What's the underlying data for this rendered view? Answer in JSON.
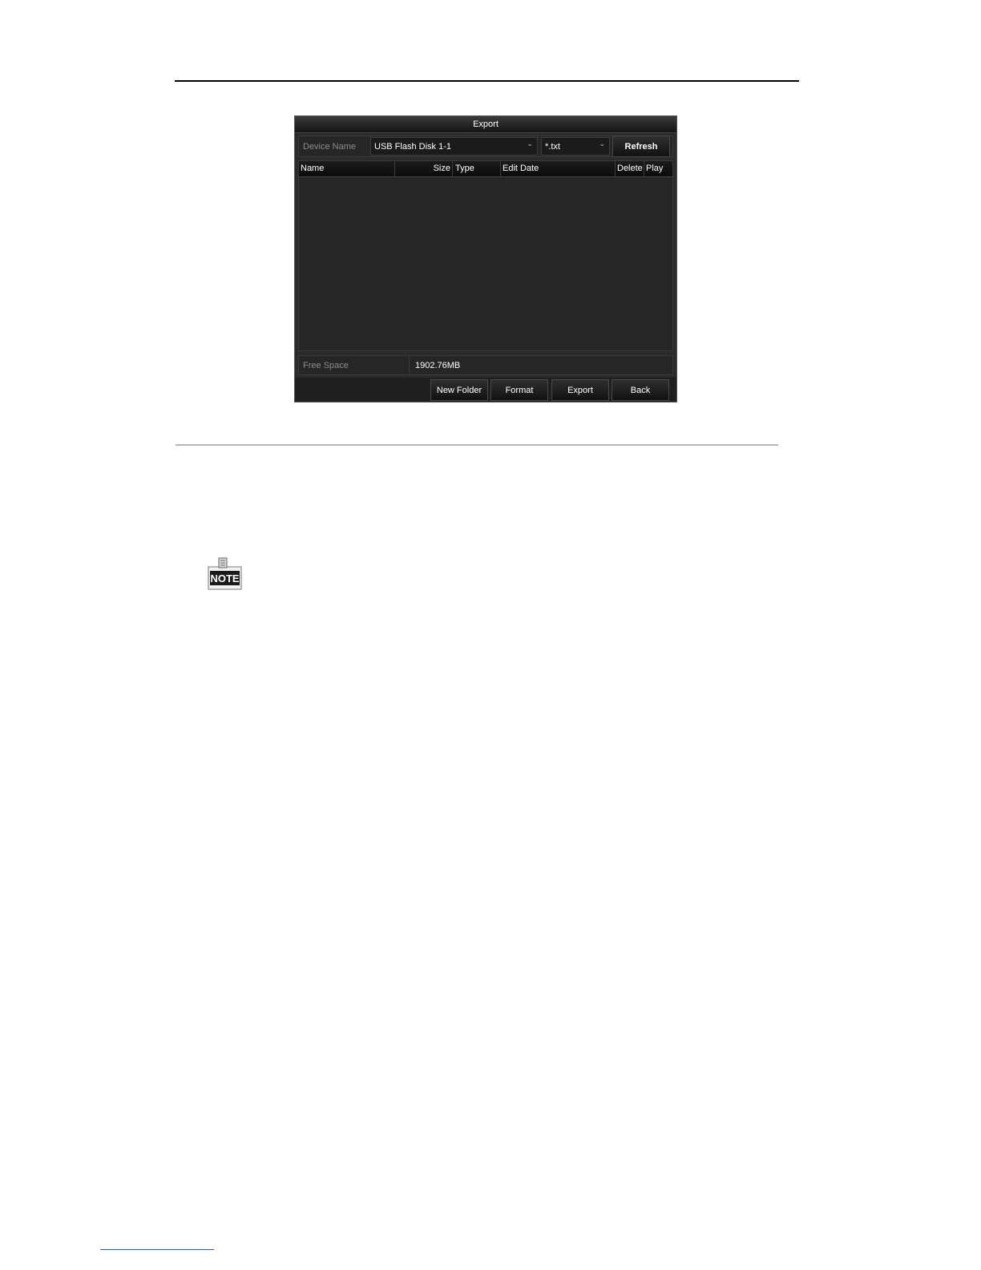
{
  "dialog": {
    "title": "Export",
    "device_name_label": "Device Name",
    "device_select_value": "USB Flash Disk 1-1",
    "filter_select_value": "*.txt",
    "refresh_label": "Refresh",
    "columns": [
      "Name",
      "Size",
      "Type",
      "Edit Date",
      "Delete",
      "Play"
    ],
    "free_space_label": "Free Space",
    "free_space_value": "1902.76MB",
    "buttons": {
      "new_folder": "New Folder",
      "format": "Format",
      "export": "Export",
      "back": "Back"
    }
  },
  "note_icon": {
    "icon": "note-icon",
    "text": "NOTE"
  }
}
